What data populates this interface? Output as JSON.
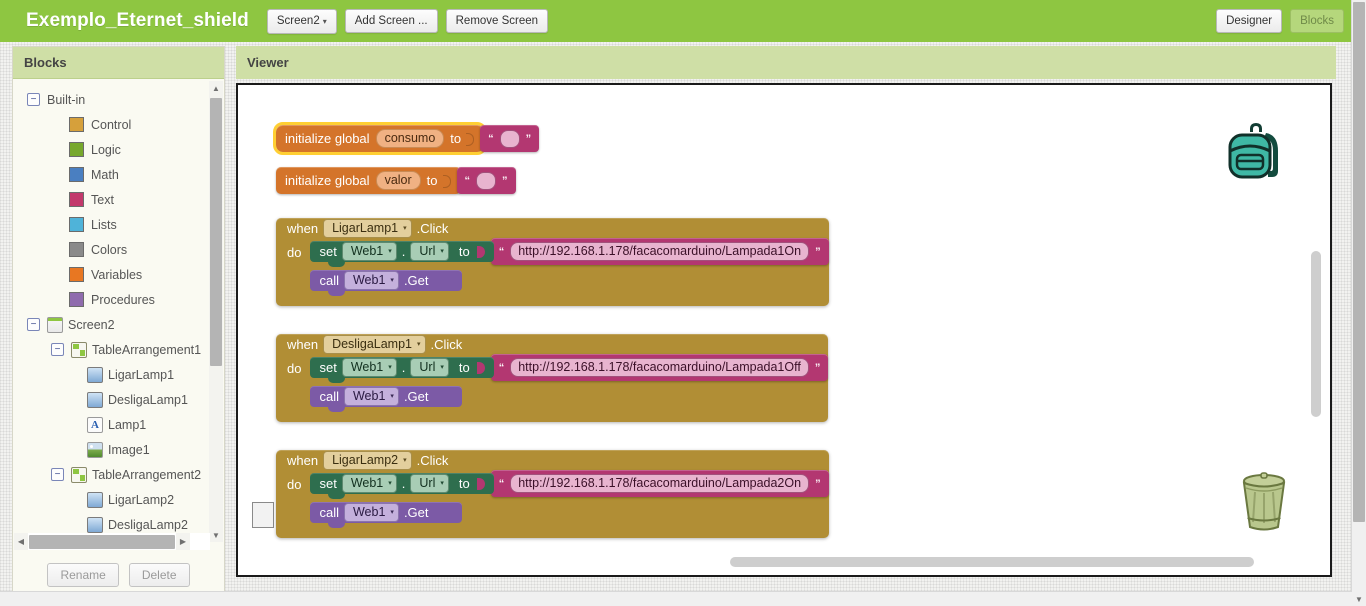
{
  "topbar": {
    "project_title": "Exemplo_Eternet_shield",
    "screen_selector": "Screen2",
    "caret": "▾",
    "add_screen": "Add Screen ...",
    "remove_screen": "Remove Screen",
    "designer_tab": "Designer",
    "blocks_tab": "Blocks",
    "accent_green": "#8ec641"
  },
  "left_panel": {
    "header": "Blocks",
    "toggle_open": "−",
    "tree": {
      "builtin": {
        "label": "Built-in",
        "items": [
          {
            "label": "Control",
            "color": "#d6a03b"
          },
          {
            "label": "Logic",
            "color": "#77a82c"
          },
          {
            "label": "Math",
            "color": "#4a7fc1"
          },
          {
            "label": "Text",
            "color": "#c2386b"
          },
          {
            "label": "Lists",
            "color": "#4fb3d9"
          },
          {
            "label": "Colors",
            "color": "#8a8a8a"
          },
          {
            "label": "Variables",
            "color": "#e87722"
          },
          {
            "label": "Procedures",
            "color": "#8f6bad"
          }
        ]
      },
      "screen": {
        "label": "Screen2",
        "children": [
          {
            "label": "TableArrangement1",
            "icon": "table-arrangement-icon",
            "level": 2
          },
          {
            "label": "LigarLamp1",
            "icon": "button-icon",
            "level": 3
          },
          {
            "label": "DesligaLamp1",
            "icon": "button-icon",
            "level": 3
          },
          {
            "label": "Lamp1",
            "icon": "label-icon",
            "level": 3
          },
          {
            "label": "Image1",
            "icon": "image-icon",
            "level": 3
          },
          {
            "label": "TableArrangement2",
            "icon": "table-arrangement-icon",
            "level": 2
          },
          {
            "label": "LigarLamp2",
            "icon": "button-icon",
            "level": 3
          },
          {
            "label": "DesligaLamp2",
            "icon": "button-icon",
            "level": 3
          }
        ]
      }
    },
    "rename_button": "Rename",
    "delete_button": "Delete",
    "scroll_arrow_up": "▲",
    "scroll_arrow_down": "▼",
    "scroll_arrow_left": "◀",
    "scroll_arrow_right": "▶"
  },
  "viewer": {
    "header": "Viewer",
    "backpack_icon": "backpack-icon",
    "trash_icon": "trash-icon"
  },
  "blocks": {
    "globals": [
      {
        "prefix": "initialize global",
        "name": "consumo",
        "to": "to",
        "value": "",
        "selected": true
      },
      {
        "prefix": "initialize global",
        "name": "valor",
        "to": "to",
        "value": "",
        "selected": false
      }
    ],
    "events": [
      {
        "when": "when",
        "component": "LigarLamp1",
        "event": ".Click",
        "do": "do",
        "set_label": "set",
        "set_component": "Web1",
        "set_dot": ".",
        "set_property": "Url",
        "set_to": "to",
        "url": "http://192.168.1.178/facacomarduino/Lampada1On",
        "call_label": "call",
        "call_component": "Web1",
        "call_method": ".Get"
      },
      {
        "when": "when",
        "component": "DesligaLamp1",
        "event": ".Click",
        "do": "do",
        "set_label": "set",
        "set_component": "Web1",
        "set_dot": ".",
        "set_property": "Url",
        "set_to": "to",
        "url": "http://192.168.1.178/facacomarduino/Lampada1Off",
        "call_label": "call",
        "call_component": "Web1",
        "call_method": ".Get"
      },
      {
        "when": "when",
        "component": "LigarLamp2",
        "event": ".Click",
        "do": "do",
        "set_label": "set",
        "set_component": "Web1",
        "set_dot": ".",
        "set_property": "Url",
        "set_to": "to",
        "url": "http://192.168.1.178/facacomarduino/Lampada2On",
        "call_label": "call",
        "call_component": "Web1",
        "call_method": ".Get"
      }
    ],
    "dropdown_arrow": "▾",
    "quote_open": "“",
    "quote_close": "”",
    "colors": {
      "variable_orange": "#d4742a",
      "text_magenta": "#b33771",
      "event_gold": "#b18e35",
      "setter_green": "#2e6e4e",
      "call_purple": "#7c5aa6",
      "selection_highlight": "#ffcf33"
    }
  }
}
